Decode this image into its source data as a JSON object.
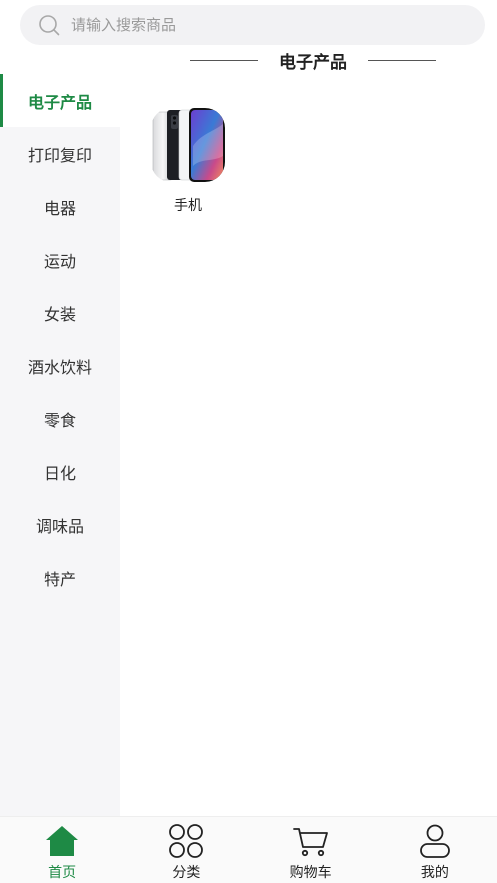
{
  "search": {
    "placeholder": "请输入搜索商品"
  },
  "sidebar": {
    "items": [
      {
        "label": "电子产品",
        "active": true
      },
      {
        "label": "打印复印"
      },
      {
        "label": "电器"
      },
      {
        "label": "运动"
      },
      {
        "label": "女装"
      },
      {
        "label": "酒水饮料"
      },
      {
        "label": "零食"
      },
      {
        "label": "日化"
      },
      {
        "label": "调味品"
      },
      {
        "label": "特产"
      }
    ]
  },
  "main": {
    "section_title": "电子产品",
    "products": [
      {
        "name": "手机",
        "icon": "phone-image"
      }
    ]
  },
  "tabbar": {
    "tabs": [
      {
        "label": "首页",
        "icon": "home-icon",
        "active": true
      },
      {
        "label": "分类",
        "icon": "category-icon"
      },
      {
        "label": "购物车",
        "icon": "cart-icon"
      },
      {
        "label": "我的",
        "icon": "user-icon"
      }
    ]
  },
  "colors": {
    "accent": "#1e8a45",
    "sidebar_bg": "#f6f6f8",
    "search_bg": "#f2f2f4"
  }
}
